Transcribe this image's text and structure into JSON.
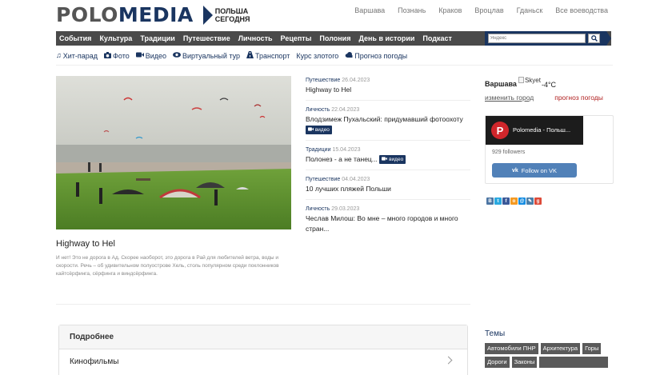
{
  "header": {
    "logo_part1": "POLO",
    "logo_part2": "MEDIA",
    "logo_sub1": "ПОЛЬША",
    "logo_sub2": "СЕГОДНЯ",
    "cities": [
      "Варшава",
      "Познань",
      "Краков",
      "Вроцлав",
      "Гданьск",
      "Все воеводства"
    ]
  },
  "nav": {
    "items": [
      "События",
      "Культура",
      "Традиции",
      "Путешествие",
      "Личность",
      "Рецепты",
      "Полония",
      "День в истории",
      "Подкаст"
    ],
    "search_placeholder": "Яндекс"
  },
  "subnav": [
    {
      "icon": "music-icon",
      "label": "Хит-парад"
    },
    {
      "icon": "camera-icon",
      "label": "Фото"
    },
    {
      "icon": "video-icon",
      "label": "Видео"
    },
    {
      "icon": "eye-icon",
      "label": "Виртуальный тур"
    },
    {
      "icon": "road-icon",
      "label": "Транспорт"
    },
    {
      "icon": "",
      "label": "Курс злотого"
    },
    {
      "icon": "cloud-icon",
      "label": "Прогноз погоды"
    }
  ],
  "hero": {
    "title": "Highway to Hel",
    "description": "И нет! Это не дорога в Ад. Скорее наоборот, это дорога в Рай для любителей ветра, воды и скорости. Речь – об удивительном полуострове Хель, столь популярном среди поклонников кайтсёрфинга, сёрфинга и виндсёрфинга."
  },
  "news": [
    {
      "category": "Путешествие",
      "date": "26.04.2023",
      "title": "Highway to Hel",
      "video": ""
    },
    {
      "category": "Личность",
      "date": "22.04.2023",
      "title": "Влодзимеж Пухальский: придумавший фотоохоту",
      "video": "видео"
    },
    {
      "category": "Традиции",
      "date": "15.04.2023",
      "title": "Полонез - а не танец...",
      "video": "видео"
    },
    {
      "category": "Путешествие",
      "date": "04.04.2023",
      "title": "10 лучших пляжей Польши",
      "video": ""
    },
    {
      "category": "Личность",
      "date": "29.03.2023",
      "title": "Чеслав Милош: Во мне – много городов и много стран...",
      "video": ""
    }
  ],
  "weather": {
    "city": "Варшава",
    "image_alt": "Skyet",
    "temp": "-4°C",
    "change_city": "изменить город",
    "forecast": "прогноз погоды"
  },
  "vk": {
    "group_name": "Polomedia - Польш...",
    "followers": "929 followers",
    "button": "Follow on VK",
    "vk_logo": "vk"
  },
  "socials": [
    {
      "name": "vk-share-icon",
      "letter": "В",
      "color": "#4c75a3"
    },
    {
      "name": "twitter-share-icon",
      "letter": "t",
      "color": "#2aa9e0"
    },
    {
      "name": "facebook-share-icon",
      "letter": "f",
      "color": "#3b5998"
    },
    {
      "name": "odnoklassniki-share-icon",
      "letter": "о",
      "color": "#f59a23"
    },
    {
      "name": "mailru-share-icon",
      "letter": "@",
      "color": "#168de2"
    },
    {
      "name": "livejournal-share-icon",
      "letter": "✎",
      "color": "#4a7ea8"
    },
    {
      "name": "googleplus-share-icon",
      "letter": "g",
      "color": "#dd4b39"
    }
  ],
  "more": {
    "title": "Подробнее",
    "row": "Кинофильмы"
  },
  "topics": {
    "title": "Темы",
    "tags": [
      "Автомобили ПНР",
      "Архитектура",
      "Горы",
      "Дороги",
      "Законы",
      ""
    ]
  }
}
